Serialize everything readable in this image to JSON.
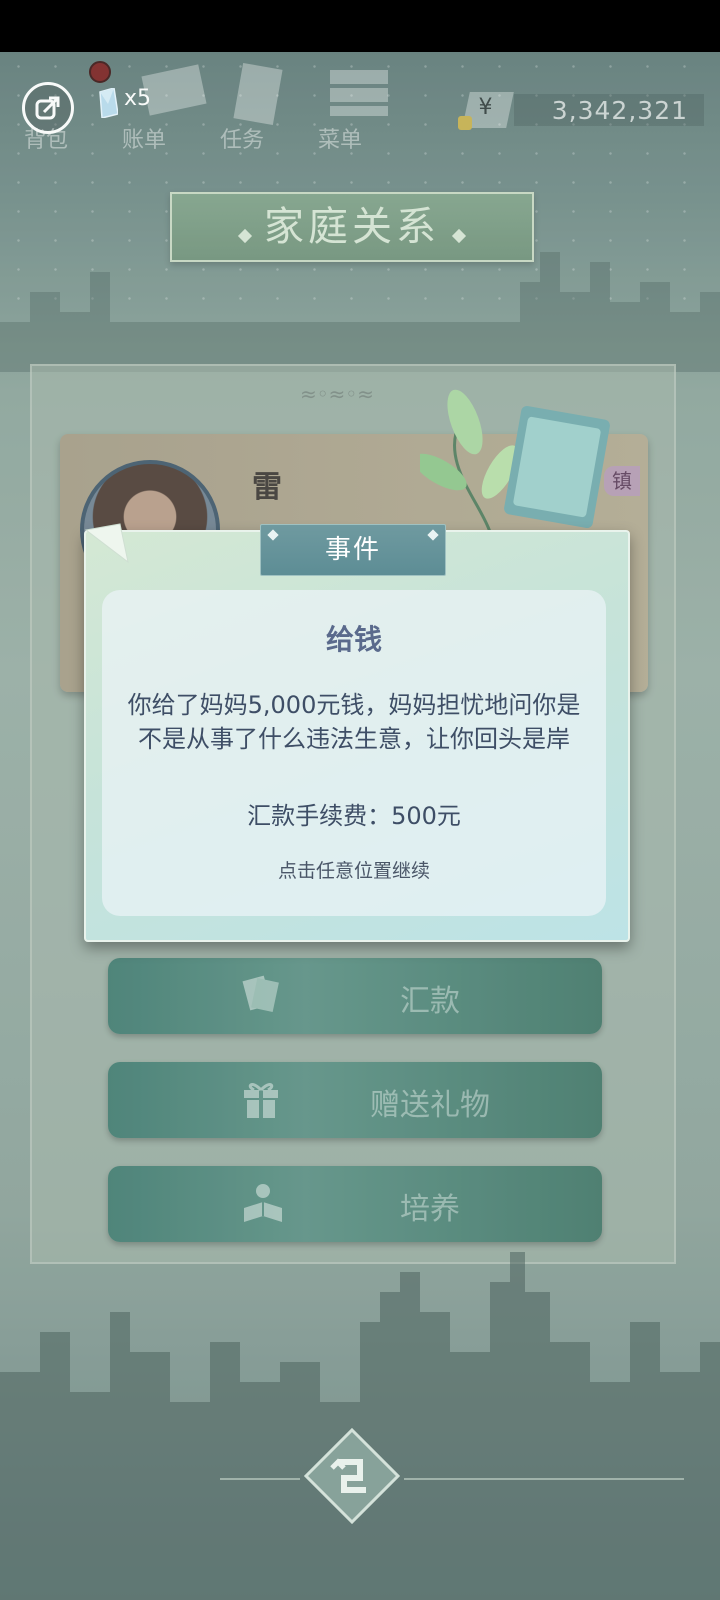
{
  "topbar": {
    "nav": [
      {
        "label": "背包"
      },
      {
        "label": "账单"
      },
      {
        "label": "任务"
      },
      {
        "label": "菜单"
      }
    ],
    "crystal_count": "x5",
    "currency_symbol": "¥",
    "money": "3,342,321"
  },
  "page_title": "家庭关系",
  "character": {
    "name": "雷",
    "tag": "镇"
  },
  "actions": [
    {
      "label": "汇款",
      "icon": "money-cards-icon"
    },
    {
      "label": "赠送礼物",
      "icon": "gift-icon"
    },
    {
      "label": "培养",
      "icon": "reading-person-icon"
    }
  ],
  "event_dialog": {
    "tab_title": "事件",
    "heading": "给钱",
    "body": "你给了妈妈5,000元钱，妈妈担忧地问你是不是从事了什么违法生意，让你回头是岸",
    "fee": "汇款手续费：500元",
    "hint": "点击任意位置继续"
  },
  "colors": {
    "accent_green": "#4c8275",
    "title_green": "#7fa188",
    "dialog_tab": "#5d8d95",
    "heading_blue": "#5a6a8c"
  }
}
